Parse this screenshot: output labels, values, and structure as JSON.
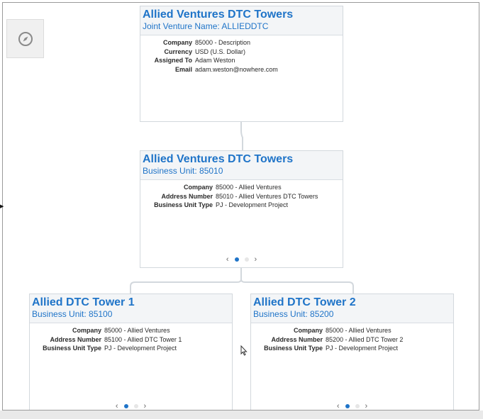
{
  "nodes": {
    "root": {
      "title": "Allied Ventures DTC Towers",
      "subtitle": "Joint Venture Name: ALLIEDDTC",
      "fields": [
        {
          "label": "Company",
          "value": "85000 - Description"
        },
        {
          "label": "Currency",
          "value": "USD (U.S. Dollar)"
        },
        {
          "label": "Assigned To",
          "value": "Adam Weston"
        },
        {
          "label": "Email",
          "value": "adam.weston@nowhere.com"
        }
      ]
    },
    "business_unit": {
      "title": "Allied Ventures DTC Towers",
      "subtitle": "Business Unit: 85010",
      "fields": [
        {
          "label": "Company",
          "value": "85000 - Allied Ventures"
        },
        {
          "label": "Address Number",
          "value": "85010 - Allied Ventures DTC Towers"
        },
        {
          "label": "Business Unit Type",
          "value": "PJ - Development Project"
        }
      ],
      "pager": {
        "prev": "‹",
        "next": "›"
      }
    },
    "tower1": {
      "title": "Allied DTC Tower 1",
      "subtitle": "Business Unit: 85100",
      "fields": [
        {
          "label": "Company",
          "value": "85000 - Allied Ventures"
        },
        {
          "label": "Address Number",
          "value": "85100 - Allied DTC Tower 1"
        },
        {
          "label": "Business Unit Type",
          "value": "PJ - Development Project"
        }
      ],
      "pager": {
        "prev": "‹",
        "next": "›"
      }
    },
    "tower2": {
      "title": "Allied DTC Tower 2",
      "subtitle": "Business Unit: 85200",
      "fields": [
        {
          "label": "Company",
          "value": "85000 - Allied Ventures"
        },
        {
          "label": "Address Number",
          "value": "85200 - Allied DTC Tower 2"
        },
        {
          "label": "Business Unit Type",
          "value": "PJ - Development Project"
        }
      ],
      "pager": {
        "prev": "‹",
        "next": "›"
      }
    }
  },
  "icons": {
    "navigator": "compass-icon",
    "side_panel": "expand-arrow-icon"
  },
  "colors": {
    "accent": "#1f74c8",
    "header_bg": "#f3f5f7",
    "connector": "#d3d8dd"
  }
}
